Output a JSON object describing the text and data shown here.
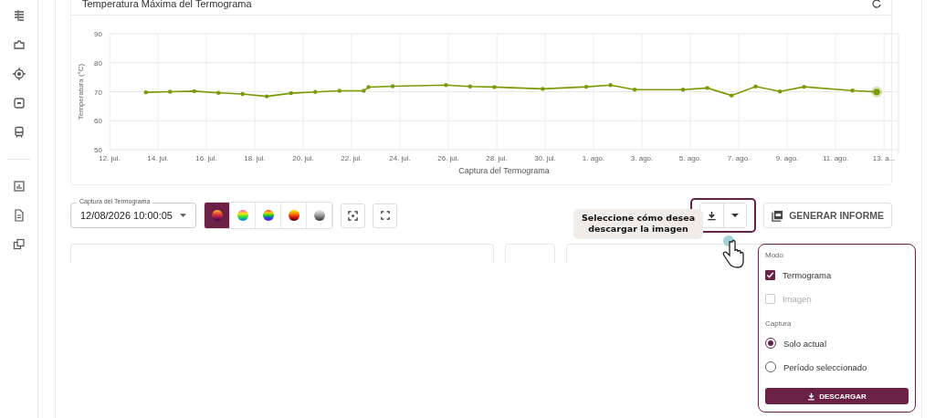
{
  "card": {
    "title": "Temperatura Máxima del Termograma",
    "chart_data": {
      "type": "line",
      "grid": true,
      "xlabel": "Captura del Termograma",
      "ylabel": "Temperatura (°C)",
      "xlim": [
        "2026-07-12",
        "2026-08-13T14:24Z"
      ],
      "ylim": [
        50,
        90
      ],
      "yticks": [
        50,
        60,
        70,
        80,
        90
      ],
      "xticks": [
        {
          "value": "2026-07-12",
          "label": "12. jul."
        },
        {
          "value": "2026-07-14",
          "label": "14. jul."
        },
        {
          "value": "2026-07-16",
          "label": "16. jul."
        },
        {
          "value": "2026-07-18",
          "label": "18. jul."
        },
        {
          "value": "2026-07-20",
          "label": "20. jul."
        },
        {
          "value": "2026-07-22",
          "label": "22. jul."
        },
        {
          "value": "2026-07-24",
          "label": "24. jul."
        },
        {
          "value": "2026-07-26",
          "label": "26. jul."
        },
        {
          "value": "2026-07-28",
          "label": "28. jul."
        },
        {
          "value": "2026-07-30",
          "label": "30. jul."
        },
        {
          "value": "2026-08-01",
          "label": "1. ago."
        },
        {
          "value": "2026-08-03",
          "label": "3. ago."
        },
        {
          "value": "2026-08-05",
          "label": "5. ago."
        },
        {
          "value": "2026-08-07",
          "label": "7. ago."
        },
        {
          "value": "2026-08-09",
          "label": "9. ago."
        },
        {
          "value": "2026-08-11",
          "label": "11. ago."
        },
        {
          "value": "2026-08-13",
          "label": "13. a..."
        }
      ],
      "x": [
        "2026-07-13T12:00Z",
        "2026-07-14T12:00Z",
        "2026-07-15T12:00Z",
        "2026-07-16T12:00Z",
        "2026-07-17T12:00Z",
        "2026-07-18T12:00Z",
        "2026-07-19T12:00Z",
        "2026-07-20T12:00Z",
        "2026-07-21T12:00Z",
        "2026-07-22T12:00Z",
        "2026-07-22T16:48Z",
        "2026-07-23T16:48Z",
        "2026-07-25T21:36Z",
        "2026-07-26T21:36Z",
        "2026-07-27T21:36Z",
        "2026-07-29T21:36Z",
        "2026-07-31T16:48Z",
        "2026-08-01T16:48Z",
        "2026-08-02T16:48Z",
        "2026-08-04T16:48Z",
        "2026-08-05T16:48Z",
        "2026-08-06T16:48Z",
        "2026-08-07T16:48Z",
        "2026-08-08T16:48Z",
        "2026-08-09T16:48Z",
        "2026-08-11T16:48Z",
        "2026-08-12T16:48Z"
      ],
      "series": [
        {
          "color": "#7a9a01",
          "values": [
            69.8,
            70,
            70.2,
            69.6,
            69.2,
            68.4,
            69.5,
            69.9,
            70.3,
            70.3,
            71.6,
            71.9,
            72.3,
            71.8,
            71.6,
            71.0,
            71.7,
            72.3,
            70.7,
            70.7,
            71.3,
            68.7,
            71.8,
            70.1,
            71.7,
            70.4,
            69.9
          ]
        }
      ]
    }
  },
  "toolbar": {
    "capture_field": {
      "label": "Captura del Termograma",
      "value": "12/08/2026 10:00:05"
    },
    "palettes": [
      {
        "kind": "ironbow",
        "selected": true
      },
      {
        "kind": "rainbow_hc",
        "selected": false
      },
      {
        "kind": "rainbow",
        "selected": false
      },
      {
        "kind": "hot",
        "selected": false
      },
      {
        "kind": "gray",
        "selected": false
      }
    ],
    "download_highlighted": true,
    "report_button": "GENERAR INFORME"
  },
  "tooltip": "Seleccione cómo desea descargar la imagen",
  "download_menu": {
    "sections": [
      {
        "heading": "Modo",
        "options": [
          {
            "kind": "checkbox",
            "label": "Termograma",
            "checked": true,
            "disabled": false
          },
          {
            "kind": "checkbox",
            "label": "Imagen",
            "checked": false,
            "disabled": true
          }
        ]
      },
      {
        "heading": "Captura",
        "options": [
          {
            "kind": "radio",
            "label": "Solo actual",
            "checked": true
          },
          {
            "kind": "radio",
            "label": "Período seleccionado",
            "checked": false
          }
        ]
      }
    ],
    "button": "DESCARGAR"
  }
}
